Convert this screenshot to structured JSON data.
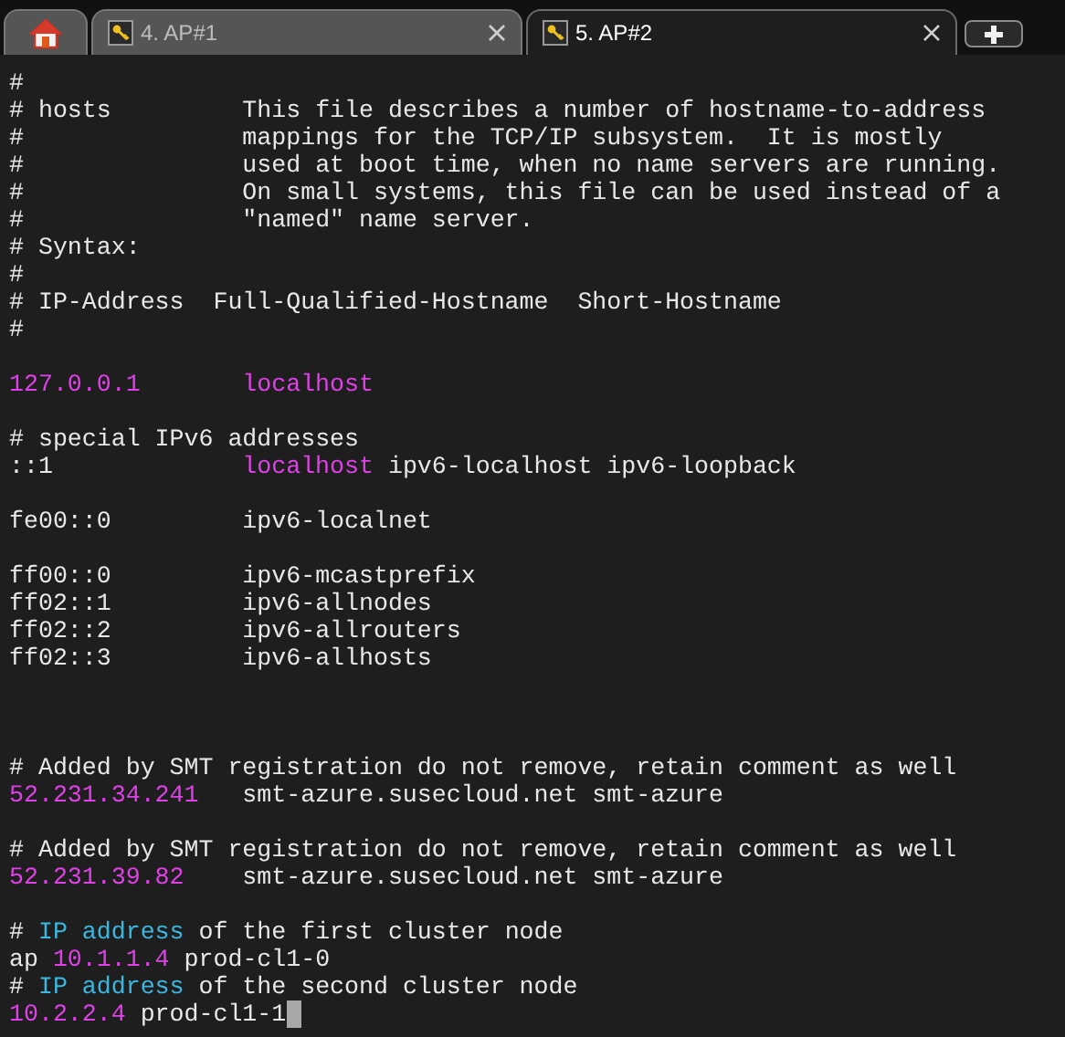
{
  "tabs": [
    {
      "kind": "home",
      "selected": false
    },
    {
      "kind": "session",
      "label": "4. AP#1",
      "selected": false
    },
    {
      "kind": "session",
      "label": "5. AP#2",
      "selected": true
    }
  ],
  "terminal": {
    "lines": [
      {
        "kind": "text",
        "segments": [
          {
            "kind": "plain",
            "text": "#"
          }
        ]
      },
      {
        "kind": "text",
        "segments": [
          {
            "kind": "plain",
            "text": "# hosts         This file describes a number of hostname-to-address"
          }
        ]
      },
      {
        "kind": "text",
        "segments": [
          {
            "kind": "plain",
            "text": "#               mappings for the TCP/IP subsystem.  It is mostly"
          }
        ]
      },
      {
        "kind": "text",
        "segments": [
          {
            "kind": "plain",
            "text": "#               used at boot time, when no name servers are running."
          }
        ]
      },
      {
        "kind": "text",
        "segments": [
          {
            "kind": "plain",
            "text": "#               On small systems, this file can be used instead of a"
          }
        ]
      },
      {
        "kind": "text",
        "segments": [
          {
            "kind": "plain",
            "text": "#               \"named\" name server."
          }
        ]
      },
      {
        "kind": "text",
        "segments": [
          {
            "kind": "plain",
            "text": "# Syntax:"
          }
        ]
      },
      {
        "kind": "text",
        "segments": [
          {
            "kind": "plain",
            "text": "#"
          }
        ]
      },
      {
        "kind": "text",
        "segments": [
          {
            "kind": "plain",
            "text": "# IP-Address  Full-Qualified-Hostname  Short-Hostname"
          }
        ]
      },
      {
        "kind": "text",
        "segments": [
          {
            "kind": "plain",
            "text": "#"
          }
        ]
      },
      {
        "kind": "blank"
      },
      {
        "kind": "text",
        "columns": true,
        "segments": [
          {
            "kind": "value",
            "text": "127.0.0.1"
          },
          {
            "kind": "value",
            "text": "localhost"
          }
        ]
      },
      {
        "kind": "blank"
      },
      {
        "kind": "text",
        "segments": [
          {
            "kind": "plain",
            "text": "# special IPv6 addresses"
          }
        ]
      },
      {
        "kind": "text",
        "columns": true,
        "segments": [
          {
            "kind": "plain",
            "text": "::1"
          },
          {
            "kind": "value",
            "text": "localhost"
          },
          {
            "kind": "plain",
            "text": " ipv6-localhost ipv6-loopback"
          }
        ]
      },
      {
        "kind": "blank"
      },
      {
        "kind": "text",
        "segments": [
          {
            "kind": "plain",
            "text": "fe00::0         ipv6-localnet"
          }
        ]
      },
      {
        "kind": "blank"
      },
      {
        "kind": "text",
        "segments": [
          {
            "kind": "plain",
            "text": "ff00::0         ipv6-mcastprefix"
          }
        ]
      },
      {
        "kind": "text",
        "segments": [
          {
            "kind": "plain",
            "text": "ff02::1         ipv6-allnodes"
          }
        ]
      },
      {
        "kind": "text",
        "segments": [
          {
            "kind": "plain",
            "text": "ff02::2         ipv6-allrouters"
          }
        ]
      },
      {
        "kind": "text",
        "segments": [
          {
            "kind": "plain",
            "text": "ff02::3         ipv6-allhosts"
          }
        ]
      },
      {
        "kind": "blank"
      },
      {
        "kind": "blank"
      },
      {
        "kind": "blank"
      },
      {
        "kind": "text",
        "segments": [
          {
            "kind": "plain",
            "text": "# Added by SMT registration do not remove, retain comment as well"
          }
        ]
      },
      {
        "kind": "text",
        "columns": true,
        "segments": [
          {
            "kind": "value",
            "text": "52.231.34.241"
          },
          {
            "kind": "plain",
            "text": "smt-azure.susecloud.net smt-azure"
          }
        ]
      },
      {
        "kind": "blank"
      },
      {
        "kind": "text",
        "segments": [
          {
            "kind": "plain",
            "text": "# Added by SMT registration do not remove, retain comment as well"
          }
        ]
      },
      {
        "kind": "text",
        "columns": true,
        "segments": [
          {
            "kind": "value",
            "text": "52.231.39.82"
          },
          {
            "kind": "plain",
            "text": "smt-azure.susecloud.net smt-azure"
          }
        ]
      },
      {
        "kind": "blank"
      },
      {
        "kind": "text",
        "segments": [
          {
            "kind": "plain",
            "text": "# "
          },
          {
            "kind": "keyword",
            "text": "IP address"
          },
          {
            "kind": "plain",
            "text": " of the first cluster node"
          }
        ]
      },
      {
        "kind": "text",
        "segments": [
          {
            "kind": "plain",
            "text": "ap "
          },
          {
            "kind": "value",
            "text": "10.1.1.4"
          },
          {
            "kind": "plain",
            "text": " prod-cl1-0"
          }
        ]
      },
      {
        "kind": "text",
        "segments": [
          {
            "kind": "plain",
            "text": "# "
          },
          {
            "kind": "keyword",
            "text": "IP address"
          },
          {
            "kind": "plain",
            "text": " of the second cluster node"
          }
        ]
      },
      {
        "kind": "text",
        "segments": [
          {
            "kind": "value",
            "text": "10.2.2.4"
          },
          {
            "kind": "plain",
            "text": " prod-cl1-1"
          }
        ]
      }
    ],
    "cursor": true
  }
}
